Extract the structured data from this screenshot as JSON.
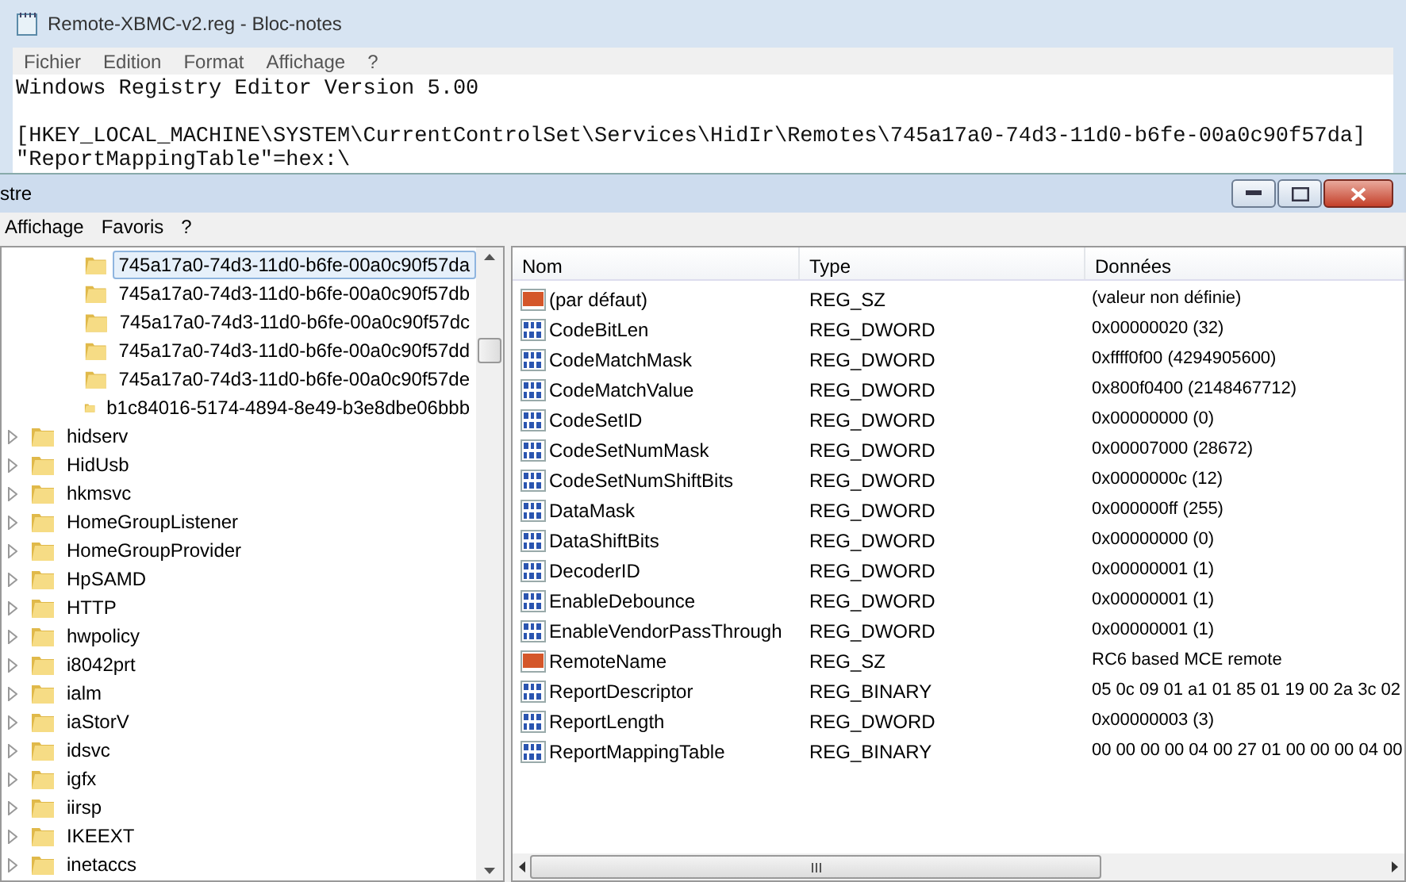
{
  "notepad": {
    "title": "Remote-XBMC-v2.reg - Bloc-notes",
    "menu": [
      "Fichier",
      "Edition",
      "Format",
      "Affichage",
      "?"
    ],
    "paragraphs": [
      [
        "Windows Registry Editor Version 5.00"
      ],
      [
        "[HKEY_LOCAL_MACHINE\\SYSTEM\\CurrentControlSet\\Services\\HidIr\\Remotes\\745a17a0-74d3-11d0-b6fe-00a0c90f57da]",
        "\"ReportMappingTable\"=hex:\\"
      ]
    ]
  },
  "regedit": {
    "title": "stre",
    "menu": [
      "Affichage",
      "Favoris",
      "?"
    ],
    "tree": {
      "continued_children": [
        {
          "label": "745a17a0-74d3-11d0-b6fe-00a0c90f57da",
          "selected": true
        },
        {
          "label": "745a17a0-74d3-11d0-b6fe-00a0c90f57db",
          "selected": false
        },
        {
          "label": "745a17a0-74d3-11d0-b6fe-00a0c90f57dc",
          "selected": false
        },
        {
          "label": "745a17a0-74d3-11d0-b6fe-00a0c90f57dd",
          "selected": false
        },
        {
          "label": "745a17a0-74d3-11d0-b6fe-00a0c90f57de",
          "selected": false
        },
        {
          "label": "b1c84016-5174-4894-8e49-b3e8dbe06bbb",
          "selected": false
        }
      ],
      "items": [
        {
          "label": "hidserv",
          "selected": false
        },
        {
          "label": "HidUsb",
          "selected": false
        },
        {
          "label": "hkmsvc",
          "selected": false
        },
        {
          "label": "HomeGroupListener",
          "selected": false
        },
        {
          "label": "HomeGroupProvider",
          "selected": false
        },
        {
          "label": "HpSAMD",
          "selected": false
        },
        {
          "label": "HTTP",
          "selected": false
        },
        {
          "label": "hwpolicy",
          "selected": false
        },
        {
          "label": "i8042prt",
          "selected": false
        },
        {
          "label": "ialm",
          "selected": false
        },
        {
          "label": "iaStorV",
          "selected": false
        },
        {
          "label": "idsvc",
          "selected": false
        },
        {
          "label": "igfx",
          "selected": false
        },
        {
          "label": "iirsp",
          "selected": false
        },
        {
          "label": "IKEEXT",
          "selected": false
        },
        {
          "label": "inetaccs",
          "selected": false
        }
      ]
    },
    "table": {
      "columns": [
        "Nom",
        "Type",
        "Données"
      ],
      "rows": [
        {
          "kind": "string",
          "name": "(par défaut)",
          "type": "REG_SZ",
          "data": "(valeur non définie)"
        },
        {
          "kind": "binary",
          "name": "CodeBitLen",
          "type": "REG_DWORD",
          "data": "0x00000020 (32)"
        },
        {
          "kind": "binary",
          "name": "CodeMatchMask",
          "type": "REG_DWORD",
          "data": "0xffff0f00 (4294905600)"
        },
        {
          "kind": "binary",
          "name": "CodeMatchValue",
          "type": "REG_DWORD",
          "data": "0x800f0400 (2148467712)"
        },
        {
          "kind": "binary",
          "name": "CodeSetID",
          "type": "REG_DWORD",
          "data": "0x00000000 (0)"
        },
        {
          "kind": "binary",
          "name": "CodeSetNumMask",
          "type": "REG_DWORD",
          "data": "0x00007000 (28672)"
        },
        {
          "kind": "binary",
          "name": "CodeSetNumShiftBits",
          "type": "REG_DWORD",
          "data": "0x0000000c (12)"
        },
        {
          "kind": "binary",
          "name": "DataMask",
          "type": "REG_DWORD",
          "data": "0x000000ff (255)"
        },
        {
          "kind": "binary",
          "name": "DataShiftBits",
          "type": "REG_DWORD",
          "data": "0x00000000 (0)"
        },
        {
          "kind": "binary",
          "name": "DecoderID",
          "type": "REG_DWORD",
          "data": "0x00000001 (1)"
        },
        {
          "kind": "binary",
          "name": "EnableDebounce",
          "type": "REG_DWORD",
          "data": "0x00000001 (1)"
        },
        {
          "kind": "binary",
          "name": "EnableVendorPassThrough",
          "type": "REG_DWORD",
          "data": "0x00000001 (1)"
        },
        {
          "kind": "string",
          "name": "RemoteName",
          "type": "REG_SZ",
          "data": "RC6 based MCE remote"
        },
        {
          "kind": "binary",
          "name": "ReportDescriptor",
          "type": "REG_BINARY",
          "data": "05 0c 09 01 a1 01 85 01 19 00 2a 3c 02"
        },
        {
          "kind": "binary",
          "name": "ReportLength",
          "type": "REG_DWORD",
          "data": "0x00000003 (3)"
        },
        {
          "kind": "binary",
          "name": "ReportMappingTable",
          "type": "REG_BINARY",
          "data": "00 00 00 00 04 00 27 01 00 00 00 04 00"
        }
      ]
    }
  }
}
